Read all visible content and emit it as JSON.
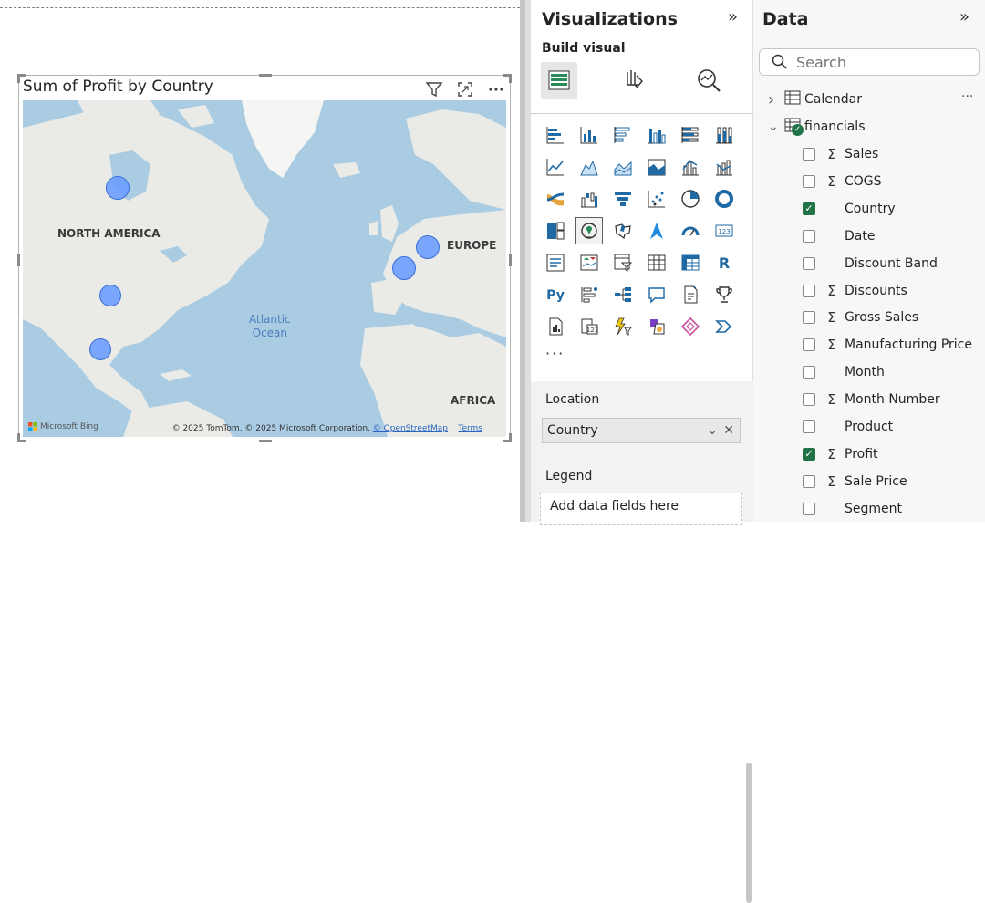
{
  "visual": {
    "title": "Sum of Profit by Country",
    "map": {
      "labels": {
        "north_america": "NORTH AMERICA",
        "europe": "EUROPE",
        "africa": "AFRICA",
        "atlantic": "Atlantic\nOcean"
      },
      "attribution_prefix": "© 2025 TomTom, © 2025 Microsoft Corporation,",
      "attribution_osm": "© OpenStreetMap",
      "attribution_terms": "Terms",
      "bing_text": "Microsoft Bing",
      "colors": {
        "bubble": "#6699ff",
        "bubble_border": "#3a6fd8",
        "water": "#a9cce3",
        "land": "#eaeae6"
      }
    }
  },
  "viz_pane": {
    "title": "Visualizations",
    "collapse_icon": "»",
    "build_label": "Build visual",
    "wells": {
      "location_label": "Location",
      "location_value": "Country",
      "legend_label": "Legend",
      "legend_placeholder": "Add data fields here"
    },
    "more_label": "···"
  },
  "data_pane": {
    "title": "Data",
    "collapse_icon": "»",
    "search_placeholder": "Search",
    "tables": [
      {
        "name": "Calendar",
        "expanded": false,
        "more": "···"
      },
      {
        "name": "financials",
        "expanded": true
      }
    ],
    "fields": [
      {
        "name": "Sales",
        "sigma": true,
        "checked": false
      },
      {
        "name": "COGS",
        "sigma": true,
        "checked": false
      },
      {
        "name": "Country",
        "sigma": false,
        "checked": true
      },
      {
        "name": "Date",
        "sigma": false,
        "checked": false
      },
      {
        "name": "Discount Band",
        "sigma": false,
        "checked": false
      },
      {
        "name": "Discounts",
        "sigma": true,
        "checked": false
      },
      {
        "name": "Gross Sales",
        "sigma": true,
        "checked": false
      },
      {
        "name": "Manufacturing Price",
        "sigma": true,
        "checked": false
      },
      {
        "name": "Month",
        "sigma": false,
        "checked": false
      },
      {
        "name": "Month Number",
        "sigma": true,
        "checked": false
      },
      {
        "name": "Product",
        "sigma": false,
        "checked": false
      },
      {
        "name": "Profit",
        "sigma": true,
        "checked": true
      },
      {
        "name": "Sale Price",
        "sigma": true,
        "checked": false
      },
      {
        "name": "Segment",
        "sigma": false,
        "checked": false
      }
    ],
    "sigma_glyph": "Σ",
    "check_glyph": "✓"
  }
}
